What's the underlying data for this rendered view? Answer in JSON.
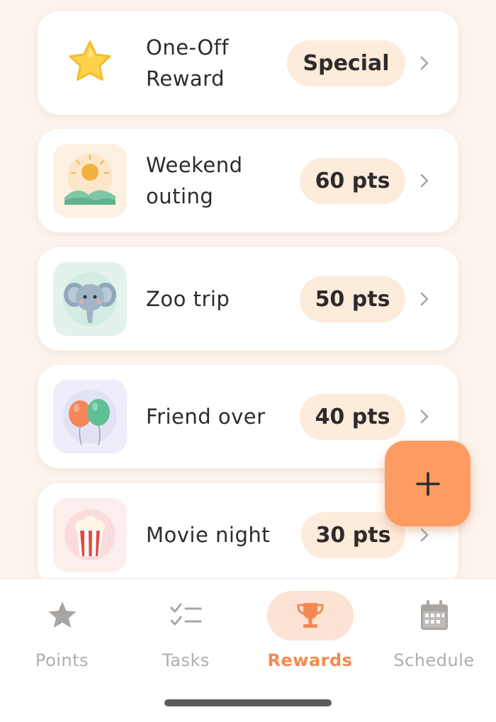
{
  "rewards": [
    {
      "title": "One-Off Reward",
      "points": "Special",
      "icon": "star-icon"
    },
    {
      "title": "Weekend outing",
      "points": "60 pts",
      "icon": "sunrise-icon"
    },
    {
      "title": "Zoo trip",
      "points": "50 pts",
      "icon": "elephant-icon"
    },
    {
      "title": "Friend over",
      "points": "40 pts",
      "icon": "balloons-icon"
    },
    {
      "title": "Movie night",
      "points": "30 pts",
      "icon": "popcorn-icon"
    }
  ],
  "fab": {
    "icon": "plus-icon"
  },
  "nav": {
    "items": [
      {
        "label": "Points",
        "icon": "star-icon",
        "active": false
      },
      {
        "label": "Tasks",
        "icon": "checklist-icon",
        "active": false
      },
      {
        "label": "Rewards",
        "icon": "trophy-icon",
        "active": true
      },
      {
        "label": "Schedule",
        "icon": "calendar-icon",
        "active": false
      }
    ]
  },
  "colors": {
    "background": "#fcf4ed",
    "accent": "#fd9b63",
    "active_label": "#f48a51",
    "pill": "#fdebdc",
    "inactive": "#b2adaa"
  }
}
